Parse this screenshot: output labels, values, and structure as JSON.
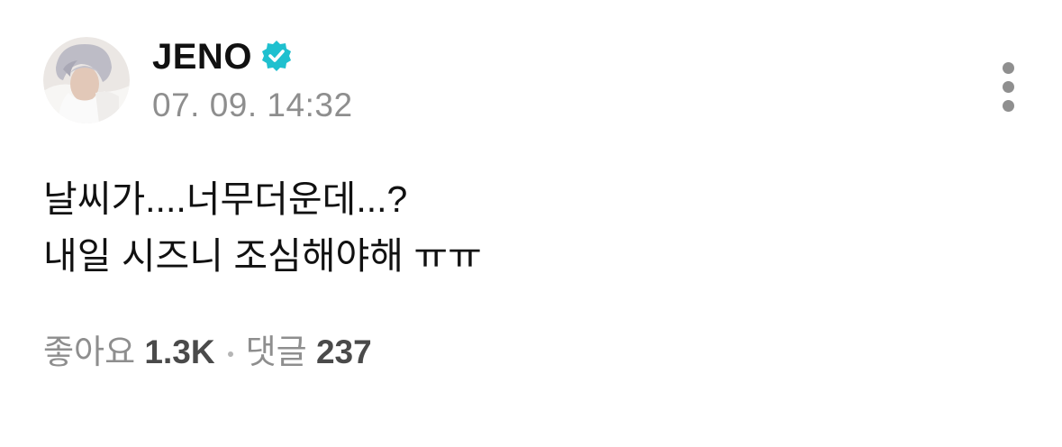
{
  "author": {
    "name": "JENO",
    "verified_icon": "verified-badge-icon",
    "verified_color": "#1fc0cf",
    "timestamp": "07. 09. 14:32"
  },
  "menu": {
    "icon": "more-vertical-icon"
  },
  "post": {
    "lines": [
      "날씨가....너무더운데...?",
      "내일 시즈니 조심해야해 ㅠㅠ"
    ]
  },
  "stats": {
    "likes_label": "좋아요",
    "likes_count": "1.3K",
    "comments_label": "댓글",
    "comments_count": "237"
  }
}
